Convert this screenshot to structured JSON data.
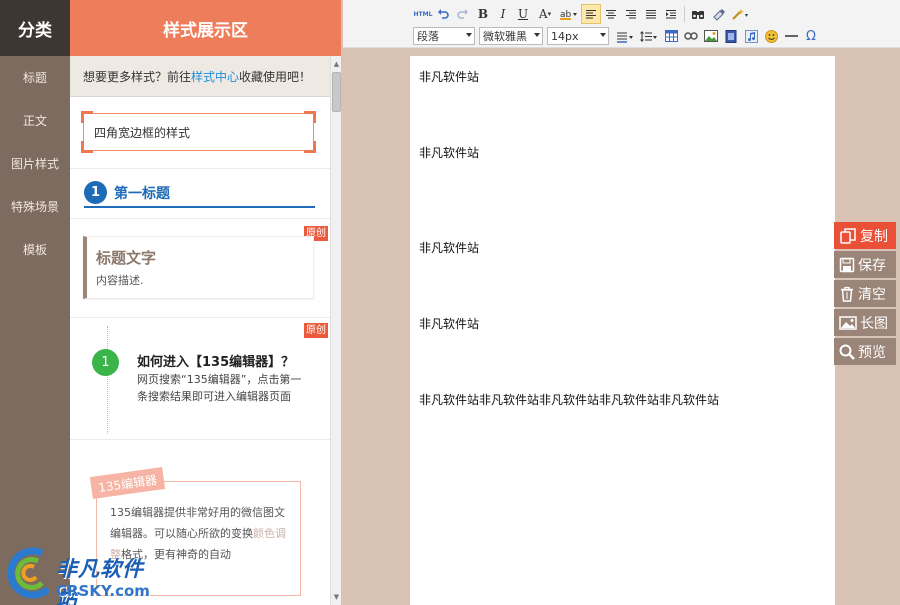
{
  "categories": {
    "header": "分类",
    "items": [
      {
        "label": "标题"
      },
      {
        "label": "正文"
      },
      {
        "label": "图片样式"
      },
      {
        "label": "特殊场景"
      },
      {
        "label": "模板"
      }
    ]
  },
  "styles": {
    "header": "样式展示区",
    "tip_prefix": "想要更多样式？前往",
    "tip_link": "样式中心",
    "tip_suffix": "收藏使用吧！",
    "frame_text": "四角宽边框的样式",
    "heading_number": "1",
    "heading_text": "第一标题",
    "badge_original": "原创",
    "title_main": "标题文字",
    "title_desc": "内容描述.",
    "how_number": "1",
    "how_title": "如何进入【135编辑器】？",
    "how_body": "网页搜索“135编辑器”，点击第一条搜索结果即可进入编辑器页面",
    "promo_tag": "135编辑器",
    "promo_body_main": "135编辑器提供非常好用的微信图文编辑器。可以随心所欲的变换",
    "promo_body_faded": "颜色调整",
    "promo_body_rest": "格式，更有神奇的自动"
  },
  "toolbar": {
    "html_label": "HTML",
    "bold": "B",
    "italic": "I",
    "underline": "U",
    "font_color": "A",
    "paragraph": "段落",
    "font_family": "微软雅黑",
    "font_size": "14px"
  },
  "document": {
    "paragraphs": [
      "非凡软件站",
      "非凡软件站",
      "非凡软件站",
      "非凡软件站",
      "非凡软件站非凡软件站非凡软件站非凡软件站非凡软件站"
    ]
  },
  "actions": [
    {
      "label": "复制",
      "icon": "copy-icon"
    },
    {
      "label": "保存",
      "icon": "save-icon"
    },
    {
      "label": "清空",
      "icon": "trash-icon"
    },
    {
      "label": "长图",
      "icon": "image-icon"
    },
    {
      "label": "预览",
      "icon": "search-icon"
    }
  ],
  "watermark": {
    "title": "非凡软件站",
    "url": "CRSKY.com"
  },
  "colors": {
    "accent": "#ed7d5b",
    "category_bg": "#7d6b5f",
    "heading_blue": "#1e6bb8",
    "action_primary": "#ea4f38"
  }
}
